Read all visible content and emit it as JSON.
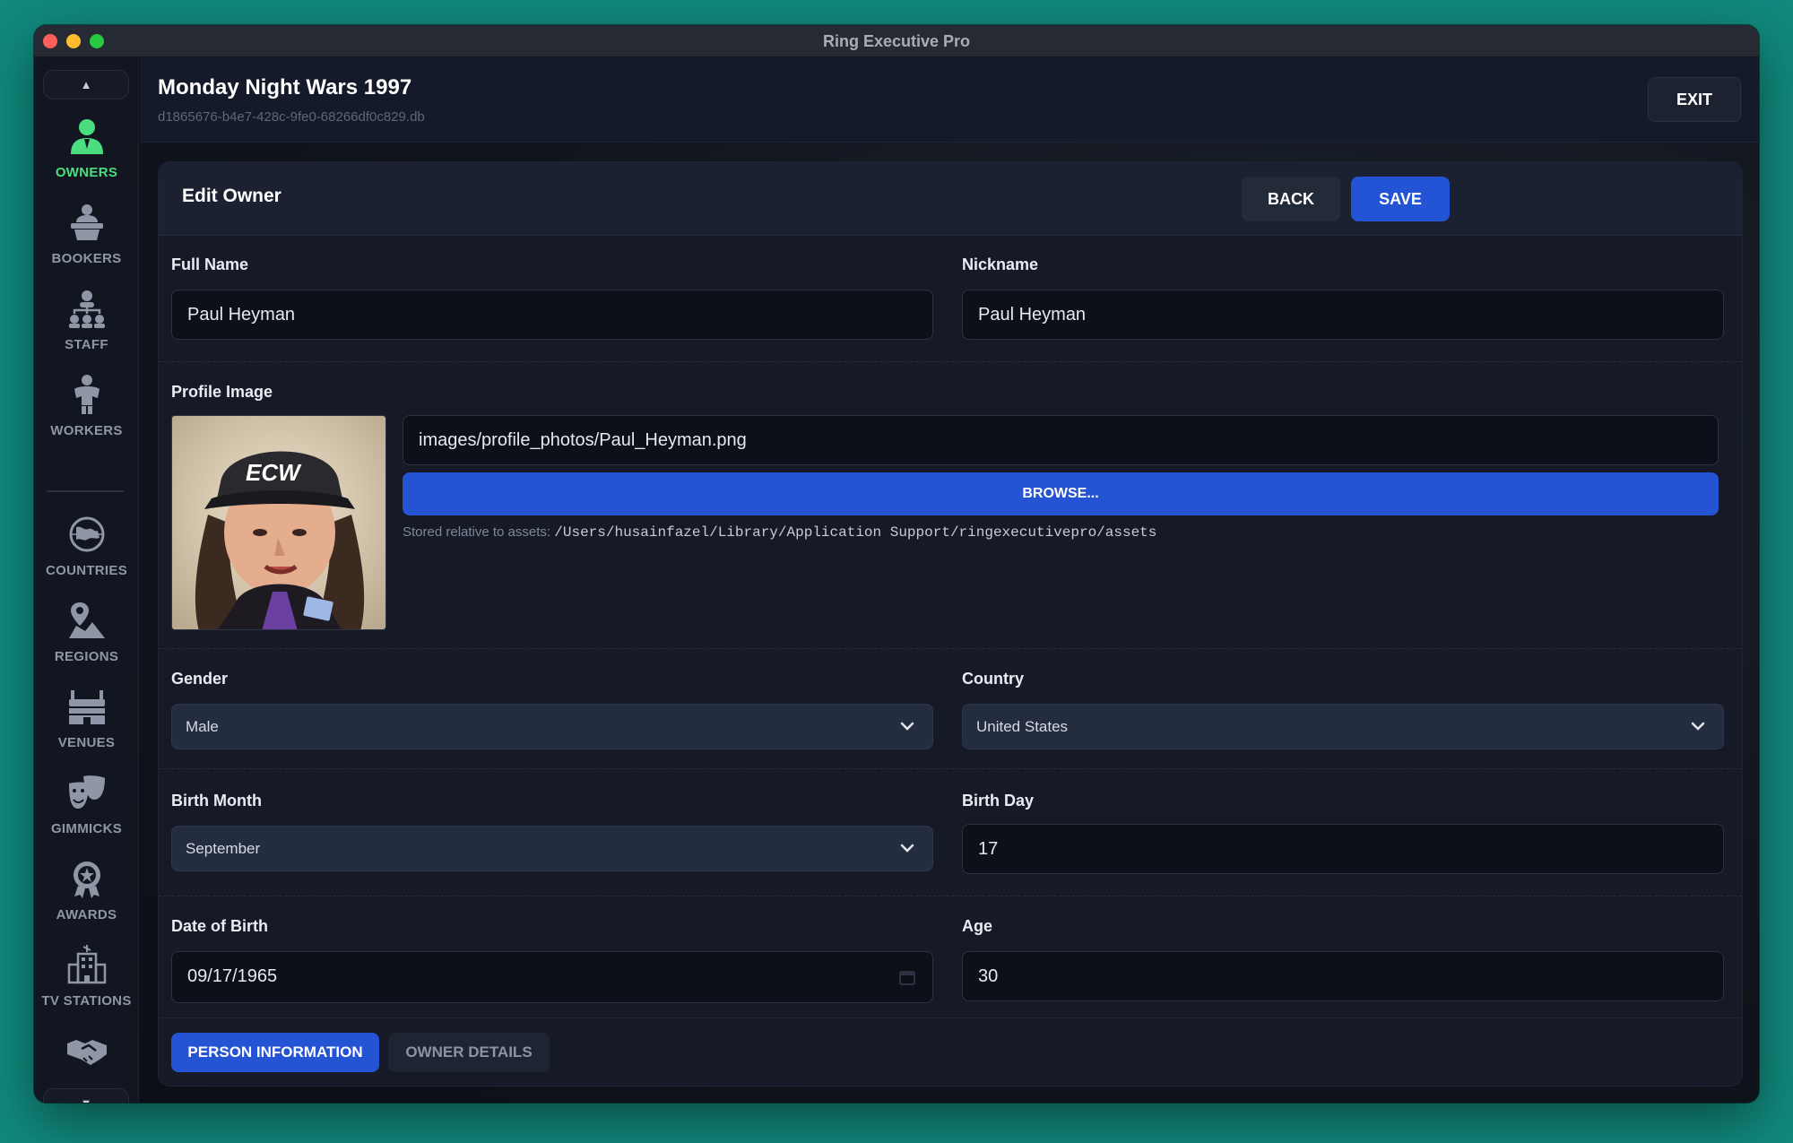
{
  "window": {
    "title": "Ring Executive Pro"
  },
  "sidebar": {
    "items": [
      {
        "label": "OWNERS",
        "icon": "person-icon",
        "active": true
      },
      {
        "label": "BOOKERS",
        "icon": "podium-icon"
      },
      {
        "label": "STAFF",
        "icon": "org-chart-icon"
      },
      {
        "label": "WORKERS",
        "icon": "wrestler-icon"
      },
      {
        "label": "COUNTRIES",
        "icon": "globe-icon"
      },
      {
        "label": "REGIONS",
        "icon": "map-pin-icon"
      },
      {
        "label": "VENUES",
        "icon": "stadium-icon"
      },
      {
        "label": "GIMMICKS",
        "icon": "theater-masks-icon"
      },
      {
        "label": "AWARDS",
        "icon": "award-icon"
      },
      {
        "label": "TV STATIONS",
        "icon": "building-icon"
      },
      {
        "label": "",
        "icon": "handshake-icon"
      }
    ],
    "scroll_up": "▲",
    "scroll_down": "▼"
  },
  "header": {
    "title": "Monday Night Wars 1997",
    "subtitle": "d1865676-b4e7-428c-9fe0-68266df0c829.db",
    "exit_label": "EXIT"
  },
  "form": {
    "title": "Edit Owner",
    "back_label": "BACK",
    "save_label": "SAVE",
    "full_name": {
      "label": "Full Name",
      "value": "Paul Heyman"
    },
    "nickname": {
      "label": "Nickname",
      "value": "Paul Heyman"
    },
    "profile_image": {
      "label": "Profile Image",
      "path": "images/profile_photos/Paul_Heyman.png",
      "browse_label": "BROWSE...",
      "stored_prefix": "Stored relative to assets:",
      "stored_path": "/Users/husainfazel/Library/Application Support/ringexecutivepro/assets",
      "photo_caption": "ECW"
    },
    "gender": {
      "label": "Gender",
      "value": "Male"
    },
    "country": {
      "label": "Country",
      "value": "United States"
    },
    "birth_month": {
      "label": "Birth Month",
      "value": "September"
    },
    "birth_day": {
      "label": "Birth Day",
      "value": "17"
    },
    "date_of_birth": {
      "label": "Date of Birth",
      "value": "09/17/1965"
    },
    "age": {
      "label": "Age",
      "value": "30"
    }
  },
  "tabs": [
    {
      "label": "PERSON INFORMATION",
      "active": true
    },
    {
      "label": "OWNER DETAILS",
      "active": false
    }
  ],
  "colors": {
    "accent": "#2354d6",
    "active_nav": "#4ade80",
    "background": "#11897d"
  }
}
